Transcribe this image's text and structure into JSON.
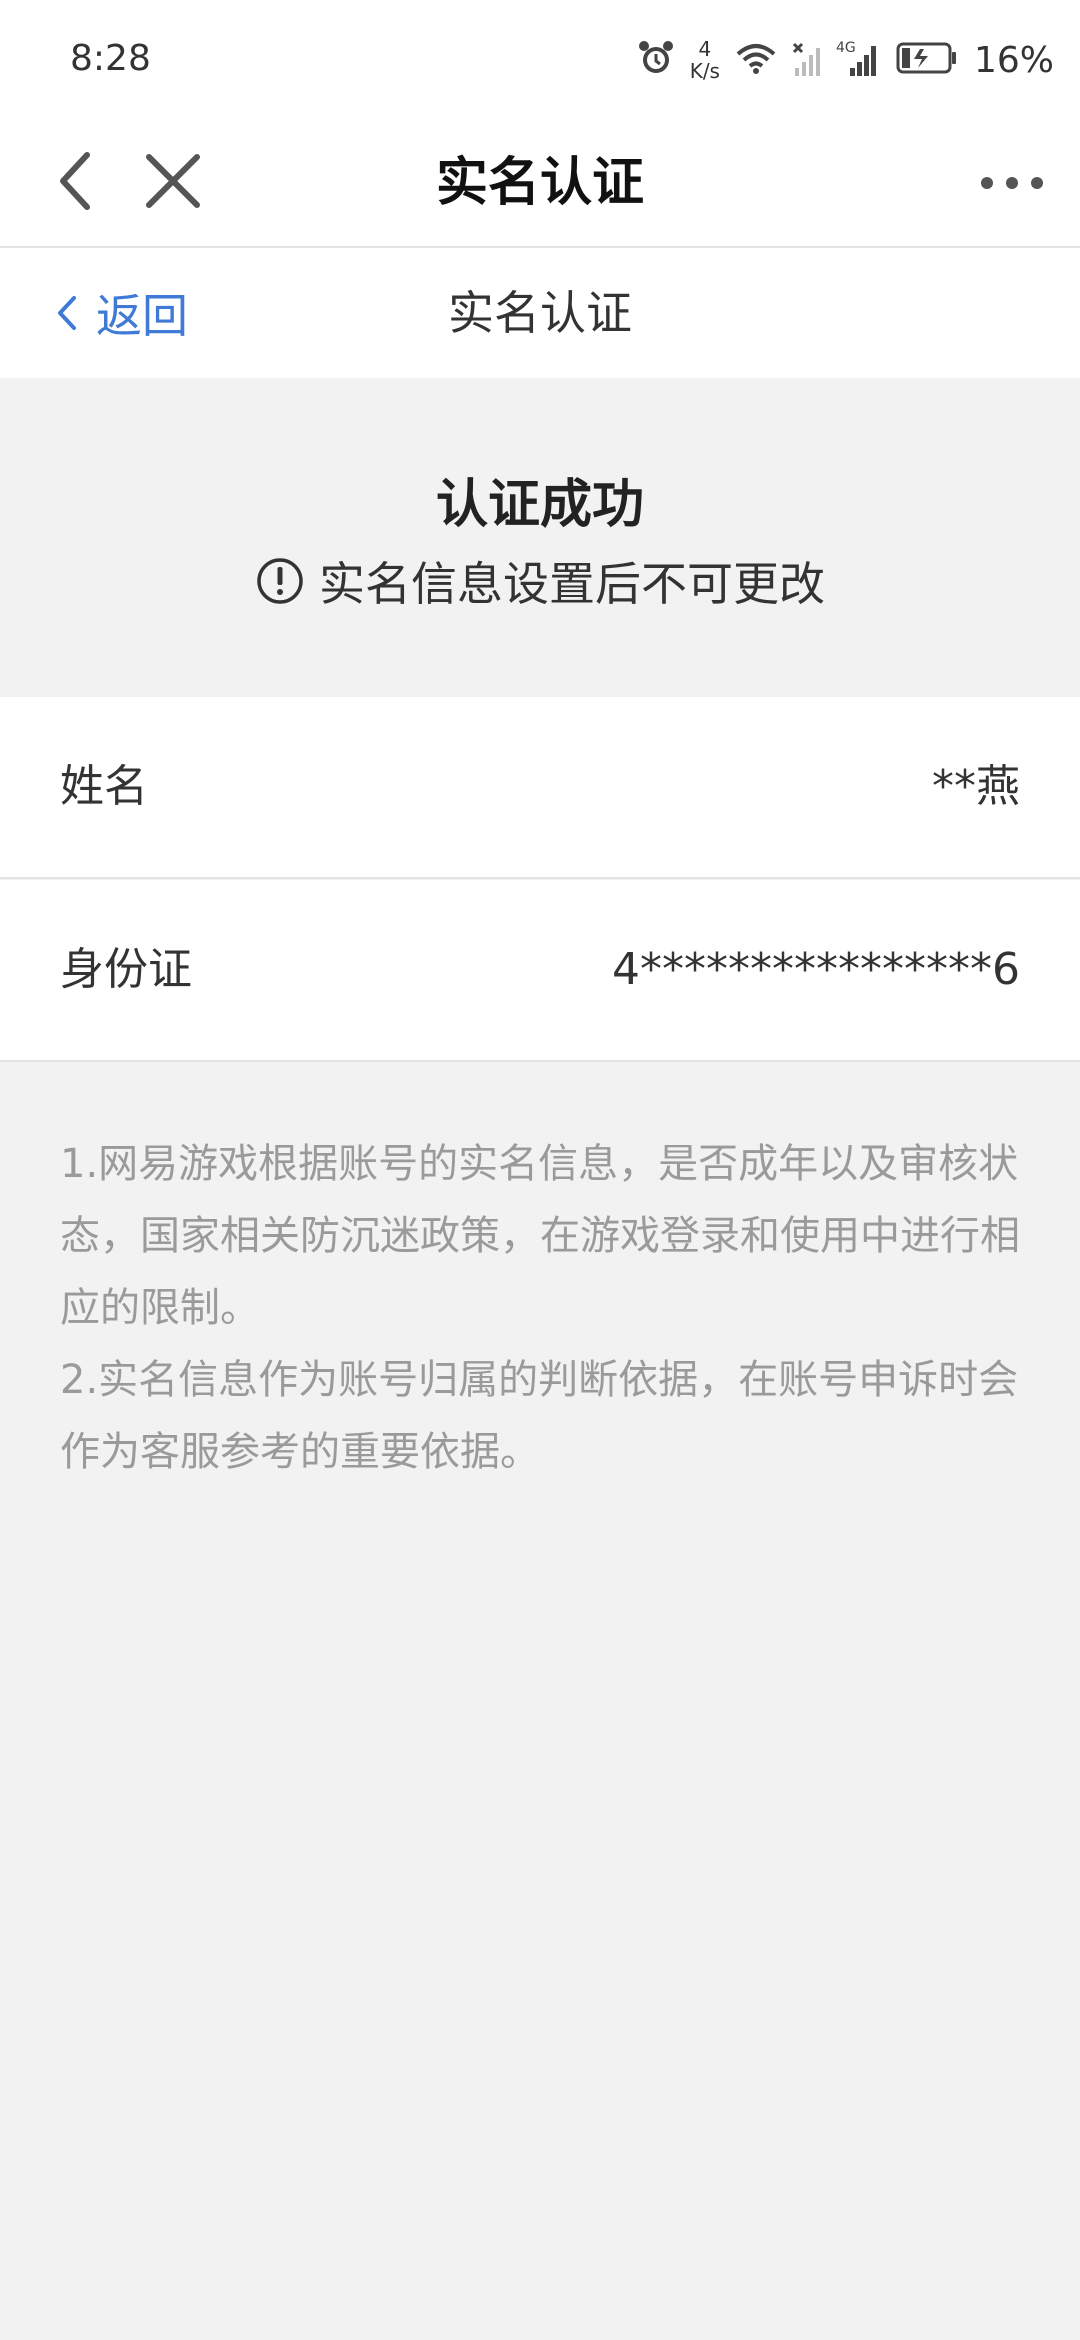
{
  "status_bar": {
    "time": "8:28",
    "speed_value": "4",
    "speed_unit": "K/s",
    "battery_percent": "16%"
  },
  "top_bar": {
    "title": "实名认证"
  },
  "nav_bar": {
    "back_label": "返回",
    "title": "实名认证"
  },
  "result": {
    "title": "认证成功",
    "note": "实名信息设置后不可更改"
  },
  "fields": {
    "name": {
      "label": "姓名",
      "value": "**燕"
    },
    "id_card": {
      "label": "身份证",
      "value": "4****************6"
    }
  },
  "notes": [
    "1.网易游戏根据账号的实名信息，是否成年以及审核状态，国家相关防沉迷政策，在游戏登录和使用中进行相应的限制。",
    "2.实名信息作为账号归属的判断依据，在账号申诉时会作为客服参考的重要依据。"
  ],
  "colors": {
    "link_blue": "#3f7bd6",
    "background": "#f2f2f2",
    "note_text": "#9a9a9a"
  }
}
